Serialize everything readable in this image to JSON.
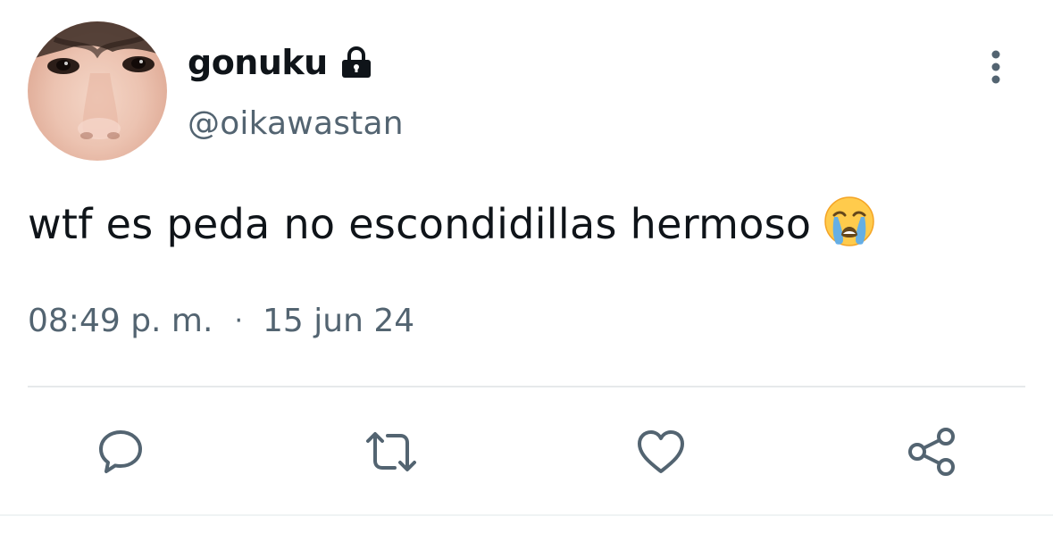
{
  "tweet": {
    "display_name": "gonuku",
    "handle": "@oikawastan",
    "text": "wtf es peda no escondidillas hermoso",
    "time": "08:49 p. m.",
    "separator": "·",
    "date": "15 jun 24",
    "protected_icon": "lock-icon",
    "emoji": "loudly-crying-face-emoji"
  },
  "actions": {
    "reply_icon": "comment-bubble-icon",
    "retweet_icon": "retweet-icon",
    "like_icon": "heart-icon",
    "share_icon": "share-icon",
    "more_icon": "vertical-ellipsis-icon"
  },
  "colors": {
    "primary_text": "#0f1419",
    "secondary_text": "#536471",
    "divider": "#e6e9eb",
    "background": "#ffffff"
  }
}
